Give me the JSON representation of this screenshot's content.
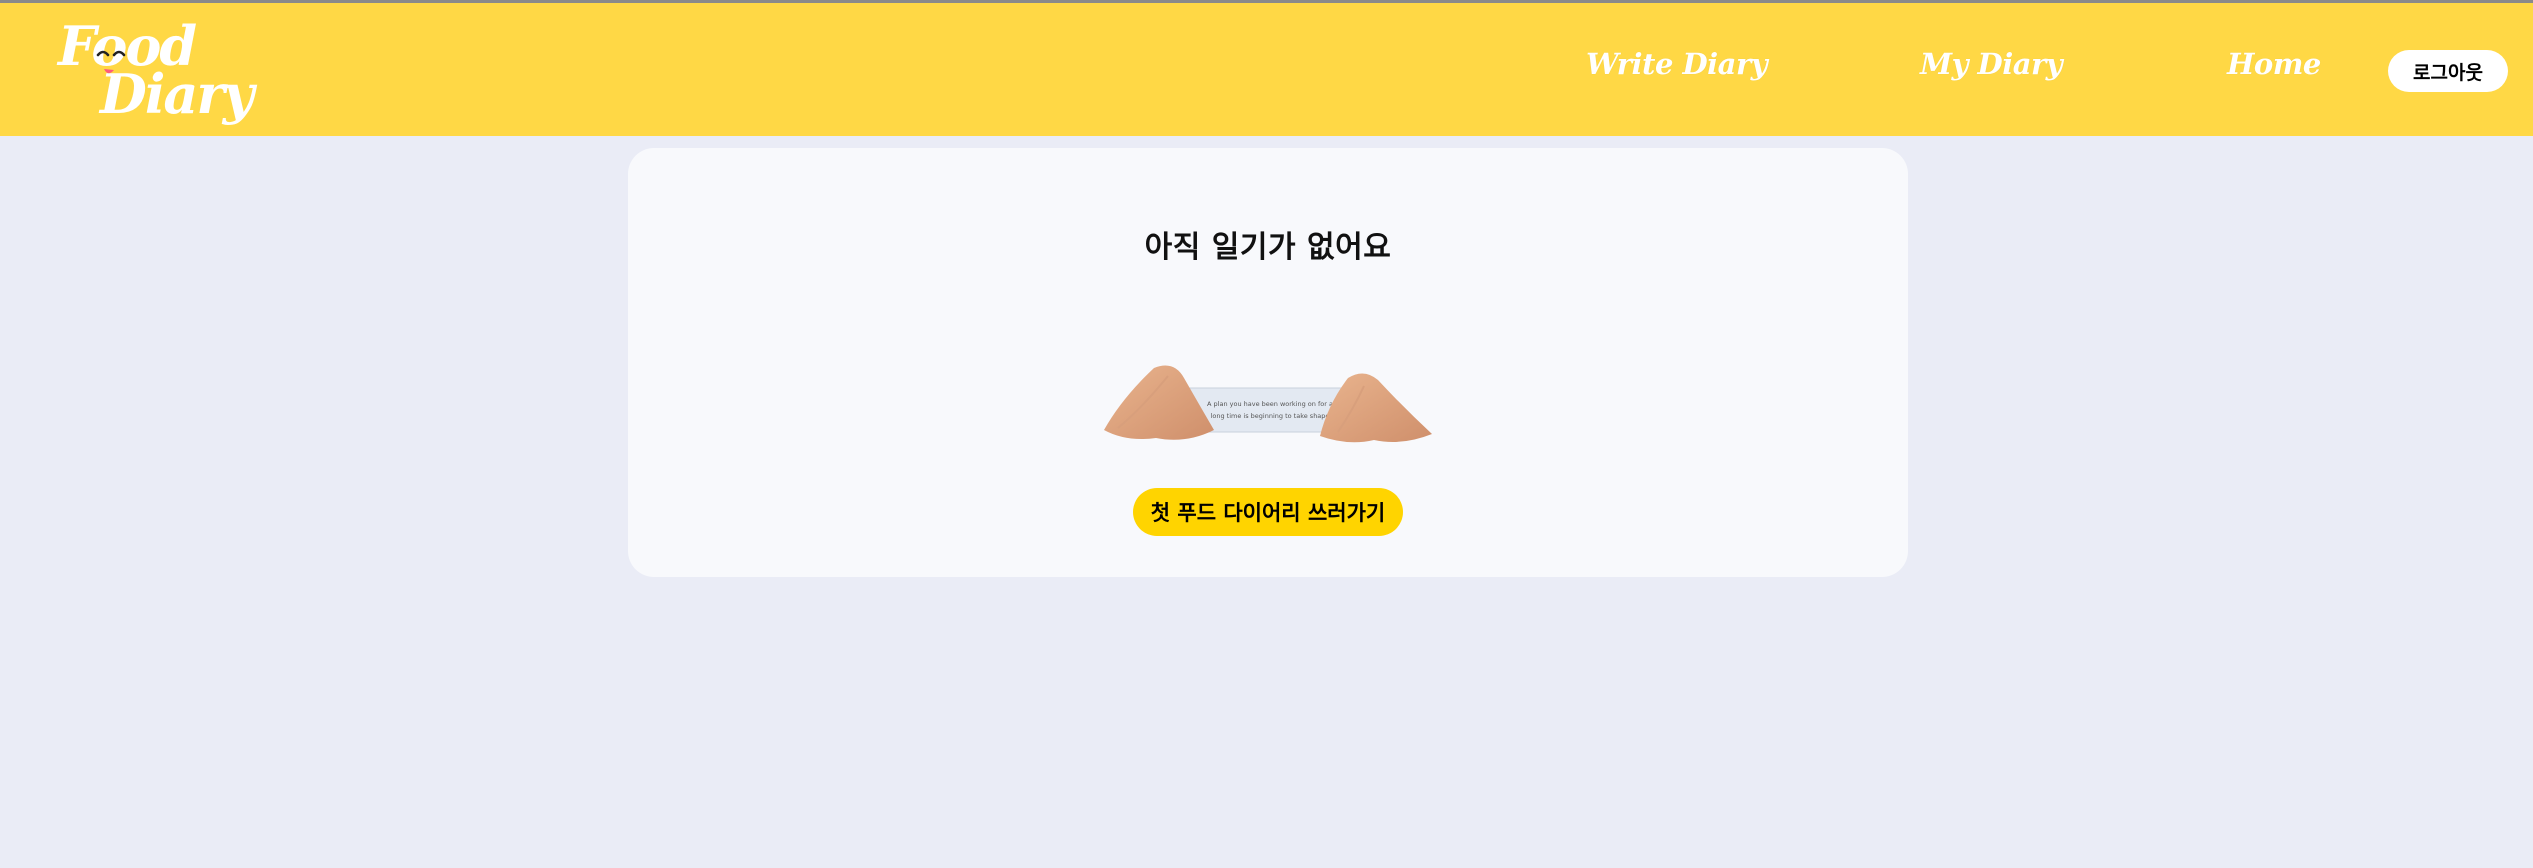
{
  "header": {
    "logo": {
      "line1": "Food",
      "line2": "Diary",
      "icon": "smiling-face-icon"
    },
    "nav": {
      "write_diary": "Write Diary",
      "my_diary": "My Diary",
      "home": "Home"
    },
    "logout_label": "로그아웃"
  },
  "main": {
    "empty_title": "아직 일기가 없어요",
    "illustration": {
      "icon": "fortune-cookie-image",
      "paper_text": [
        "A plan you have been working on for a",
        "long time is beginning to take shape"
      ]
    },
    "cta_label": "첫 푸드 다이어리 쓰러가기"
  },
  "colors": {
    "header_bg": "#ffd845",
    "page_bg": "#eaecf6",
    "card_bg": "#f8f9fc",
    "cta_bg": "#ffd400"
  }
}
